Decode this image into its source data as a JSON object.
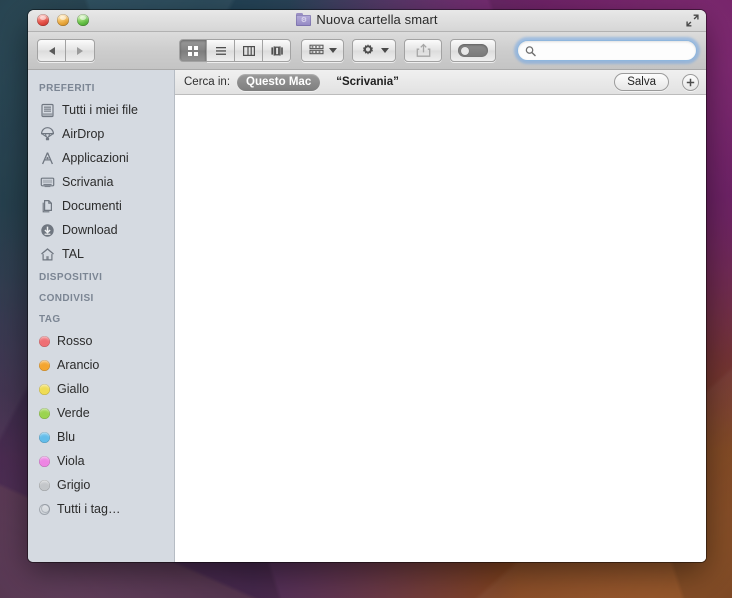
{
  "window": {
    "title": "Nuova cartella smart",
    "title_icon": "smart-folder-icon",
    "traffic_lights": [
      {
        "name": "close-button",
        "color": "#e24c42"
      },
      {
        "name": "minimize-button",
        "color": "#e9a73b"
      },
      {
        "name": "maximize-button",
        "color": "#62bf43"
      }
    ],
    "fullscreen_icon": "fullscreen-expand-icon"
  },
  "toolbar": {
    "nav": {
      "back_icon": "chevron-left-icon",
      "forward_icon": "chevron-right-icon",
      "back_enabled": false,
      "forward_enabled": false
    },
    "views": [
      {
        "id": "icon",
        "icon": "grid-view-icon",
        "selected": true
      },
      {
        "id": "list",
        "icon": "list-view-icon",
        "selected": false
      },
      {
        "id": "column",
        "icon": "column-view-icon",
        "selected": false
      },
      {
        "id": "flow",
        "icon": "coverflow-view-icon",
        "selected": false
      }
    ],
    "arrange": {
      "icon": "arrange-grid-icon",
      "caret": "chevron-down-icon"
    },
    "action": {
      "icon": "gear-icon",
      "caret": "chevron-down-icon"
    },
    "share": {
      "icon": "share-icon",
      "enabled": false
    },
    "tags": {
      "icon": "tag-toggle-icon"
    }
  },
  "search": {
    "icon": "search-icon",
    "value": "",
    "placeholder": "",
    "focused": true
  },
  "search_bar": {
    "label": "Cerca in:",
    "scopes": [
      {
        "label": "Questo Mac",
        "selected": true
      },
      {
        "label": "“Scrivania”",
        "selected": false
      }
    ],
    "save_label": "Salva",
    "add_icon": "plus-icon"
  },
  "sidebar": {
    "sections": [
      {
        "header": "PREFERITI",
        "items": [
          {
            "label": "Tutti i miei file",
            "icon": "all-my-files-icon"
          },
          {
            "label": "AirDrop",
            "icon": "airdrop-parachute-icon"
          },
          {
            "label": "Applicazioni",
            "icon": "applications-icon"
          },
          {
            "label": "Scrivania",
            "icon": "desktop-icon"
          },
          {
            "label": "Documenti",
            "icon": "documents-icon"
          },
          {
            "label": "Download",
            "icon": "downloads-arrow-icon"
          },
          {
            "label": "TAL",
            "icon": "home-icon"
          }
        ]
      },
      {
        "header": "DISPOSITIVI",
        "items": []
      },
      {
        "header": "CONDIVISI",
        "items": []
      },
      {
        "header": "TAG",
        "items": [
          {
            "label": "Rosso",
            "icon": "tag-dot-icon",
            "color": "#ef6f74"
          },
          {
            "label": "Arancio",
            "icon": "tag-dot-icon",
            "color": "#f4a52e"
          },
          {
            "label": "Giallo",
            "icon": "tag-dot-icon",
            "color": "#efdc54"
          },
          {
            "label": "Verde",
            "icon": "tag-dot-icon",
            "color": "#9bd44f"
          },
          {
            "label": "Blu",
            "icon": "tag-dot-icon",
            "color": "#63bdea"
          },
          {
            "label": "Viola",
            "icon": "tag-dot-icon",
            "color": "#ed85e3"
          },
          {
            "label": "Grigio",
            "icon": "tag-dot-icon",
            "color": "#c3c6c9"
          },
          {
            "label": "Tutti i tag…",
            "icon": "all-tags-icon",
            "color": ""
          }
        ]
      }
    ]
  },
  "content": {
    "items": []
  },
  "statusbar": {
    "text": ""
  }
}
